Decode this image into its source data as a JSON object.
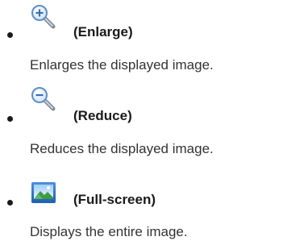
{
  "items": [
    {
      "icon": "zoom-in-icon",
      "label": "(Enlarge)",
      "description": "Enlarges the displayed image."
    },
    {
      "icon": "zoom-out-icon",
      "label": "(Reduce)",
      "description": "Reduces the displayed image."
    },
    {
      "icon": "fullscreen-icon",
      "label": "(Full-screen)",
      "description": "Displays the entire image."
    }
  ],
  "colors": {
    "text": "#333333",
    "bullet": "#1a1a1a",
    "magnifier_lens": "#5b8fc9",
    "picture_frame": "#2f6fc0"
  }
}
